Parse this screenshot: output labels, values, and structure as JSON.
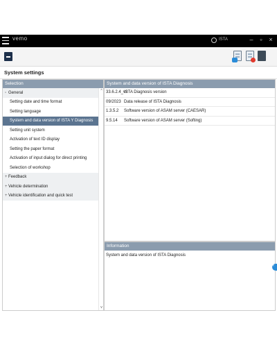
{
  "titlebar": {
    "app_title": "vemo",
    "logo_text": "ISTA",
    "minimize": "–",
    "restore": "▫",
    "close": "×"
  },
  "toolbar": {
    "back_icon": "back-icon",
    "icons": [
      "help-chat-icon",
      "report-icon",
      "book-icon"
    ]
  },
  "heading": "System settings",
  "left": {
    "header": "Selection",
    "groups": [
      {
        "label": "General",
        "expanded": true,
        "children": [
          {
            "label": "Setting date and time format",
            "selected": false
          },
          {
            "label": "Setting language",
            "selected": false
          },
          {
            "label": "System and data version of ISTA Y Diagnosis",
            "selected": true
          },
          {
            "label": "Setting unit system",
            "selected": false
          },
          {
            "label": "Activation of text ID display",
            "selected": false
          },
          {
            "label": "Setting the paper format",
            "selected": false
          },
          {
            "label": "Activation of input dialog for direct printing",
            "selected": false
          },
          {
            "label": "Selection of workshop",
            "selected": false
          }
        ]
      },
      {
        "label": "Feedback",
        "expanded": false,
        "children": []
      },
      {
        "label": "Vehicle determination",
        "expanded": false,
        "children": []
      },
      {
        "label": "Vehicle identification and quick test",
        "expanded": false,
        "children": []
      }
    ],
    "scroll_up": "^",
    "scroll_down": "v"
  },
  "right": {
    "header": "System and data version of ISTA Diagnosis",
    "rows": [
      {
        "value": "33.6.2.4_v2",
        "desc": "ISTA Diagnosis version"
      },
      {
        "value": "09/2023",
        "desc": "Data release of ISTA Diagnosis"
      },
      {
        "value": "1.3.5.2",
        "desc": "Software version of ASAM server (CAESAR)"
      },
      {
        "value": "9.5.14",
        "desc": "Software version of ASAM server (Softing)"
      }
    ]
  },
  "info": {
    "header": "Information",
    "text": "System and data version of ISTA Diagnosis"
  },
  "colors": {
    "titlebar": "#000000",
    "panel_header": "#8b9cae",
    "selected_row": "#5b7490"
  }
}
